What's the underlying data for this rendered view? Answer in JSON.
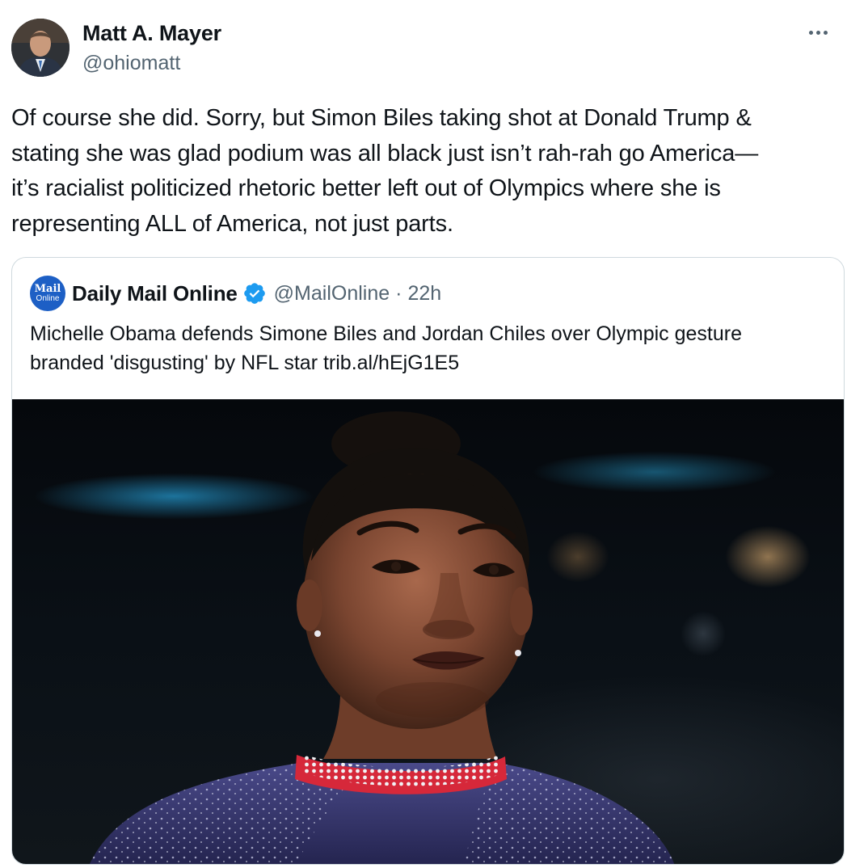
{
  "author": {
    "display_name": "Matt A. Mayer",
    "handle": "@ohiomatt"
  },
  "more_label": "More",
  "tweet": {
    "text": "Of course she did. Sorry, but Simon Biles taking shot at Donald Trump &\nstating she was glad podium was all black just isn’t rah-rah go America—\nit’s racialist politicized rhetoric better left out of Olympics where she is\nrepresenting ALL of America, not just parts."
  },
  "quote": {
    "logo_line1": "Mail",
    "logo_line2": "Online",
    "display_name": "Daily Mail Online",
    "verified_icon": "verified-badge-icon",
    "handle": "@MailOnline",
    "separator": "·",
    "time": "22h",
    "text": "Michelle Obama defends Simone Biles and Jordan Chiles over Olympic gesture\nbranded 'disgusting' by NFL star trib.al/hEjG1E5",
    "image_icon": "athlete-photo"
  },
  "colors": {
    "text": "#0f1419",
    "secondary": "#536471",
    "border": "#cfd9de",
    "verified": "#1d9bf0",
    "mail_brand": "#1d5fc5"
  }
}
